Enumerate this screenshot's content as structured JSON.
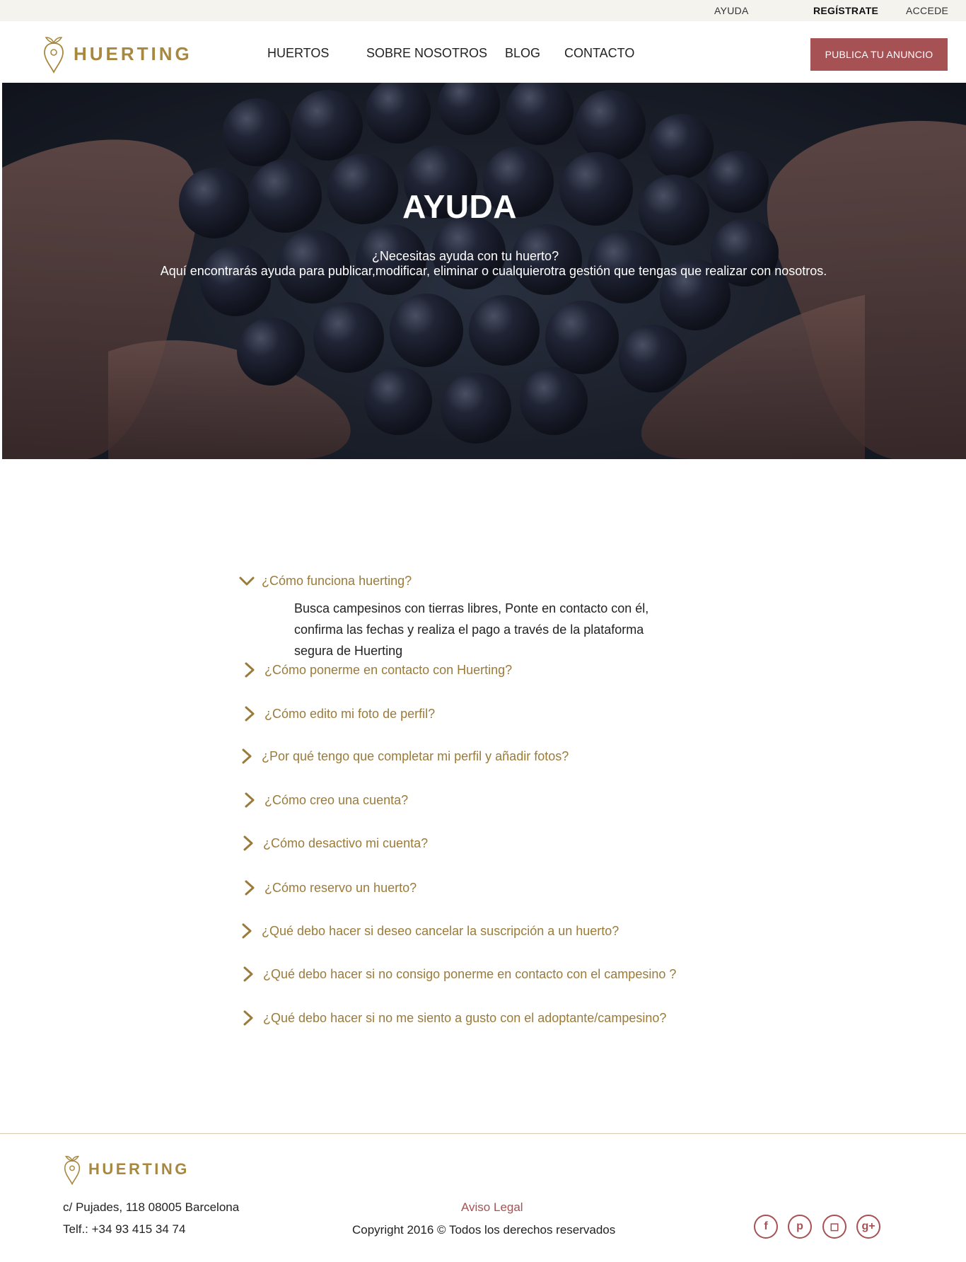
{
  "topbar": {
    "ayuda": "AYUDA",
    "registrate": "REGÍSTRATE",
    "accede": "ACCEDE"
  },
  "header": {
    "logo": "HUERTING",
    "nav": [
      "HUERTOS",
      "SOBRE NOSOTROS",
      "BLOG",
      "CONTACTO"
    ],
    "cta": "PUBLICA TU ANUNCIO"
  },
  "hero": {
    "title": "AYUDA",
    "subtitle_line1": "¿Necesitas ayuda con tu huerto?",
    "subtitle_line2": "Aquí encontrarás ayuda para publicar,modificar, eliminar o cualquierotra gestión que tengas que realizar con nosotros."
  },
  "faq": {
    "items": [
      {
        "question": "¿Cómo funciona huerting?",
        "expanded": true,
        "icon": "chevron-down-icon"
      },
      {
        "question": "¿Cómo ponerme en contacto con Huerting?",
        "expanded": false,
        "icon": "chevron-right-icon"
      },
      {
        "question": "¿Cómo edito mi foto de perfil?",
        "expanded": false,
        "icon": "chevron-right-icon"
      },
      {
        "question": "¿Por qué tengo que completar mi perfil y añadir fotos?",
        "expanded": false,
        "icon": "chevron-right-icon"
      },
      {
        "question": "¿Cómo creo una cuenta?",
        "expanded": false,
        "icon": "chevron-right-icon"
      },
      {
        "question": "¿Cómo desactivo mi cuenta?",
        "expanded": false,
        "icon": "chevron-right-icon"
      },
      {
        "question": "¿Cómo reservo un huerto?",
        "expanded": false,
        "icon": "chevron-right-icon"
      },
      {
        "question": "¿Qué debo hacer si deseo cancelar la suscripción a un huerto?",
        "expanded": false,
        "icon": "chevron-right-icon"
      },
      {
        "question": "¿Qué debo hacer si no consigo ponerme en contacto con el campesino ?",
        "expanded": false,
        "icon": "chevron-right-icon"
      },
      {
        "question": "¿Qué debo hacer si no me siento a gusto con el adoptante/campesino?",
        "expanded": false,
        "icon": "chevron-right-icon"
      }
    ],
    "answer_line1": "Busca campesinos con tierras libres, Ponte en contacto con él,",
    "answer_line2": "confirma las fechas y realiza el pago a través de la plataforma",
    "answer_line3": "segura de Huerting"
  },
  "footer": {
    "logo": "HUERTING",
    "address": "c/ Pujades, 118 08005 Barcelona",
    "phone": "Telf.: +34 93 415 34 74",
    "legal": "Aviso Legal",
    "copyright": "Copyright 2016 © Todos los derechos reservados",
    "social": [
      {
        "icon": "facebook-icon",
        "glyph": "f"
      },
      {
        "icon": "pinterest-icon",
        "glyph": "p"
      },
      {
        "icon": "instagram-icon",
        "glyph": "◻"
      },
      {
        "icon": "google-plus-icon",
        "glyph": "g+"
      }
    ]
  },
  "colors": {
    "accent_gold": "#a8883e",
    "accent_red": "#a65154",
    "topbar_bg": "#f5f3ee"
  }
}
